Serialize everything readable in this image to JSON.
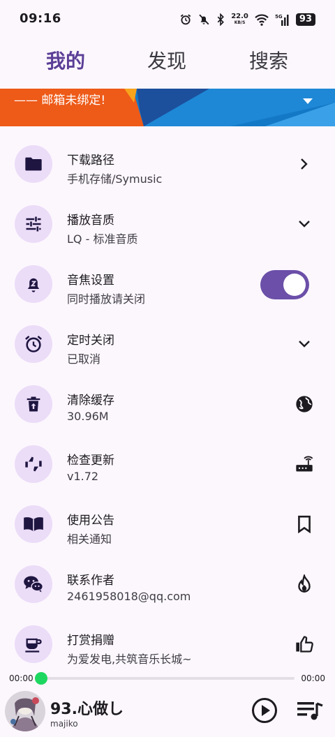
{
  "status": {
    "time": "09:16",
    "net_speed": "22.0",
    "net_unit": "KB/S",
    "battery": "93"
  },
  "tabs": [
    {
      "label": "我的",
      "active": true
    },
    {
      "label": "发现",
      "active": false
    },
    {
      "label": "搜索",
      "active": false
    }
  ],
  "banner": {
    "label": "—— 邮箱未绑定!"
  },
  "settings": [
    {
      "title": "下载路径",
      "subtitle": "手机存储/Symusic",
      "icon": "folder-icon",
      "trailing": "chevron-right-icon"
    },
    {
      "title": "播放音质",
      "subtitle": "LQ - 标准音质",
      "icon": "tune-icon",
      "trailing": "chevron-down-icon"
    },
    {
      "title": "音焦设置",
      "subtitle": "同时播放请关闭",
      "icon": "bell-z-icon",
      "trailing": "toggle",
      "toggle_on": true
    },
    {
      "title": "定时关闭",
      "subtitle": "已取消",
      "icon": "alarm-icon",
      "trailing": "chevron-down-icon"
    },
    {
      "title": "清除缓存",
      "subtitle": "30.96M",
      "icon": "delete-icon",
      "trailing": "globe-icon"
    },
    {
      "title": "检查更新",
      "subtitle": "v1.72",
      "icon": "thumbs-updown-icon",
      "trailing": "router-icon"
    },
    {
      "title": "使用公告",
      "subtitle": "相关通知",
      "icon": "book-icon",
      "trailing": "bookmark-icon"
    },
    {
      "title": "联系作者",
      "subtitle": "2461958018@qq.com",
      "icon": "wechat-icon",
      "trailing": "flame-icon"
    },
    {
      "title": "打赏捐赠",
      "subtitle": "为爱发电,共筑音乐长城~",
      "icon": "coffee-icon",
      "trailing": "thumb-up-icon"
    }
  ],
  "progress": {
    "current": "00:00",
    "total": "00:00",
    "fraction": 0
  },
  "player": {
    "title": "93.心做し",
    "artist": "majiko"
  },
  "colors": {
    "accent": "#5b3e96",
    "icon_bg": "#ebdcf8",
    "toggle": "#6b4fa8",
    "thumb": "#1ed760"
  }
}
